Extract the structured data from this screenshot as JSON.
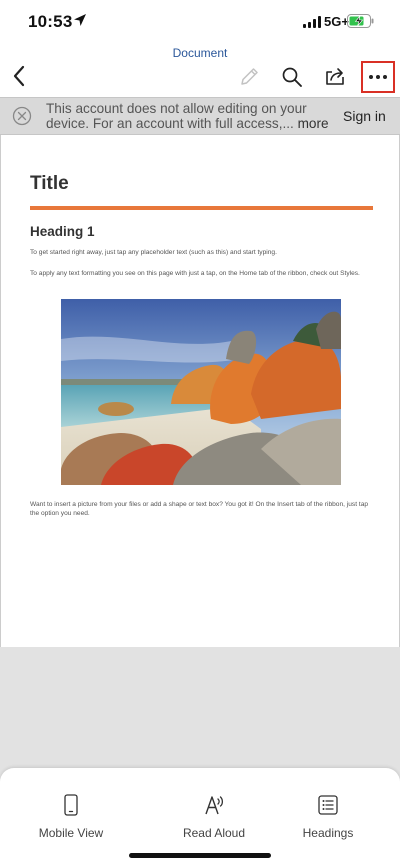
{
  "status_bar": {
    "time": "10:53",
    "network": "5G+"
  },
  "nav": {
    "document_title": "Document",
    "icons": [
      "chevron-left-icon",
      "pencil-icon",
      "search-icon",
      "share-icon",
      "more-icon"
    ]
  },
  "banner": {
    "message": "This account does not allow editing on your device. For an account with full access,...",
    "more_label": "more",
    "sign_in_label": "Sign in"
  },
  "document": {
    "title": "Title",
    "heading1": "Heading 1",
    "paragraph1": "To get started right away, just tap any placeholder text (such as this) and start typing.",
    "paragraph2": "To apply any text formatting you see on this page with just a tap, on the Home tab of the ribbon, check out Styles.",
    "paragraph3": "Want to insert a picture from your files or add a shape or text box? You got it! On the Insert tab of the ribbon, just tap the option you need.",
    "accent_color": "#e8773a"
  },
  "bottom_bar": {
    "tabs": [
      {
        "label": "Mobile View",
        "icon": "phone-icon"
      },
      {
        "label": "Read Aloud",
        "icon": "read-aloud-icon"
      },
      {
        "label": "Headings",
        "icon": "headings-list-icon"
      }
    ]
  },
  "colors": {
    "brand": "#2b579a",
    "highlight": "#d93025"
  }
}
